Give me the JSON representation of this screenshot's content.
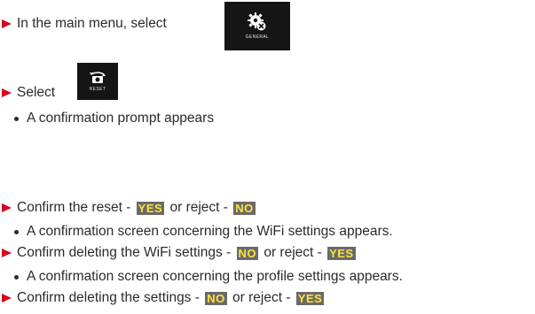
{
  "steps": [
    {
      "kind": "arrow",
      "text": "In the main menu, select"
    },
    {
      "kind": "arrow",
      "text": "Select"
    },
    {
      "kind": "bullet",
      "text": "A confirmation prompt appears"
    },
    {
      "kind": "arrow",
      "pre": "Confirm the reset - ",
      "tag1": "YES",
      "mid": " or reject - ",
      "tag2": "NO"
    },
    {
      "kind": "bullet",
      "text": "A confirmation screen concerning the WiFi settings appears."
    },
    {
      "kind": "arrow",
      "pre": "Confirm deleting the WiFi settings - ",
      "tag1": "NO",
      "mid": " or reject - ",
      "tag2": "YES"
    },
    {
      "kind": "bullet",
      "text": "A confirmation screen concerning the profile settings appears."
    },
    {
      "kind": "arrow",
      "pre": "Confirm deleting the settings - ",
      "tag1": "NO",
      "mid": " or reject - ",
      "tag2": "YES"
    }
  ],
  "tiles": {
    "general": {
      "label": "GENERAL",
      "icon": "gear-wrench-icon"
    },
    "reset": {
      "label": "RESET",
      "icon": "camera-reset-icon"
    }
  },
  "colors": {
    "arrow": "#d6001c",
    "tag_bg": "#6a6a6a",
    "tag_text": "#ffe23a"
  }
}
